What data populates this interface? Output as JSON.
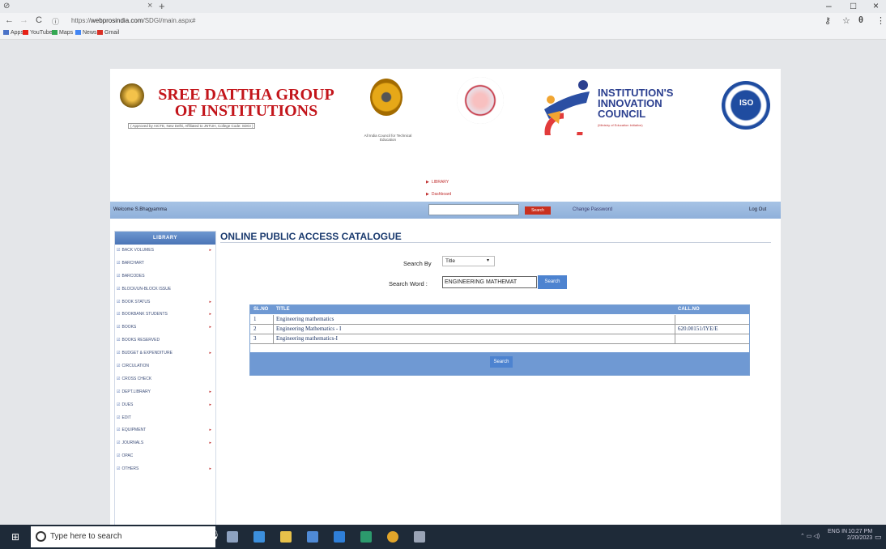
{
  "browser": {
    "tab_close": "×",
    "tab_new": "+",
    "url_host": "webprosindia.com",
    "url_prefix": "https://",
    "url_path": "/SDGI/main.aspx#",
    "window_controls": [
      "–",
      "□",
      "×"
    ],
    "bookmarks": [
      {
        "label": "Apps",
        "color": "#4a72c7"
      },
      {
        "label": "YouTube",
        "color": "#e62117"
      },
      {
        "label": "Maps",
        "color": "#34a853"
      },
      {
        "label": "News",
        "color": "#4285f4"
      },
      {
        "label": "Gmail",
        "color": "#d93025"
      }
    ]
  },
  "header": {
    "college_name": "SREE DATTHA GROUP OF INSTITUTIONS",
    "approval_note": "( Approved by AICTE, New Delhi, Affiliated to JNTUH, College Code: SDGI )",
    "aicte_caption": "All India Council for Technical Education",
    "iic_title_1": "INSTITUTION'S",
    "iic_title_2": "INNOVATION",
    "iic_title_3": "COUNCIL",
    "iic_subtitle": "(Ministry of Education Initiative)",
    "iso_text": "ISO"
  },
  "nav_links": [
    "LIBRARY",
    "Dashboard"
  ],
  "topbar": {
    "welcome": "Welcome S.Bhagyamma",
    "search_value": "",
    "search_button": "Search",
    "change_password": "Change Password",
    "logout": "Log Out"
  },
  "sidebar": {
    "heading": "LIBRARY",
    "items": [
      {
        "label": "BACK VOLUMES",
        "submenu": true
      },
      {
        "label": "BARCHART",
        "submenu": false
      },
      {
        "label": "BARCODES",
        "submenu": false
      },
      {
        "label": "BLOCK/UN-BLOCK ISSUE",
        "submenu": false
      },
      {
        "label": "BOOK STATUS",
        "submenu": true
      },
      {
        "label": "BOOKBANK STUDENTS",
        "submenu": true
      },
      {
        "label": "BOOKS",
        "submenu": true
      },
      {
        "label": "BOOKS RESERVED",
        "submenu": false
      },
      {
        "label": "BUDGET & EXPENDITURE",
        "submenu": true
      },
      {
        "label": "CIRCULATION",
        "submenu": false
      },
      {
        "label": "CROSS CHECK",
        "submenu": false
      },
      {
        "label": "DEPT.LIBRARY",
        "submenu": true
      },
      {
        "label": "DUES",
        "submenu": true
      },
      {
        "label": "EDIT",
        "submenu": false
      },
      {
        "label": "EQUIPMENT",
        "submenu": true
      },
      {
        "label": "JOURNALS",
        "submenu": true
      },
      {
        "label": "OPAC",
        "submenu": false
      },
      {
        "label": "OTHERS",
        "submenu": true
      }
    ],
    "submenu_arrow": "▸"
  },
  "catalogue": {
    "title": "ONLINE PUBLIC ACCESS CATALOGUE",
    "search_by_label": "Search By",
    "search_by_value": "Title",
    "search_word_label": "Search Word :",
    "search_word_value": "ENGINEERING MATHEMAT",
    "search_button": "Search",
    "columns": [
      "SL.NO",
      "TITLE",
      "CALL.NO"
    ],
    "rows": [
      {
        "sl": "1",
        "title": "Engineering mathematics",
        "call": ""
      },
      {
        "sl": "2",
        "title": "Engineering Mathematics - I",
        "call": "620.00151/IYE/E"
      },
      {
        "sl": "3",
        "title": "Engineering mathematics-I",
        "call": ""
      }
    ],
    "footer_button": "Search"
  },
  "taskbar": {
    "search_placeholder": "Type here to search",
    "tray_lang": "ENG IN",
    "tray_time": "10:27 PM",
    "tray_date": "2/20/2023",
    "app_icons": [
      {
        "name": "task-view",
        "color": "#8da2c0"
      },
      {
        "name": "edge",
        "color": "#3c8fdc"
      },
      {
        "name": "file-explorer",
        "color": "#e7c14a"
      },
      {
        "name": "store",
        "color": "#4f8ad6"
      },
      {
        "name": "mail",
        "color": "#2f7fd8"
      },
      {
        "name": "photos",
        "color": "#2c9a6d"
      },
      {
        "name": "chrome",
        "color": "#e2a52a"
      },
      {
        "name": "paint",
        "color": "#9aa4b6"
      }
    ]
  }
}
